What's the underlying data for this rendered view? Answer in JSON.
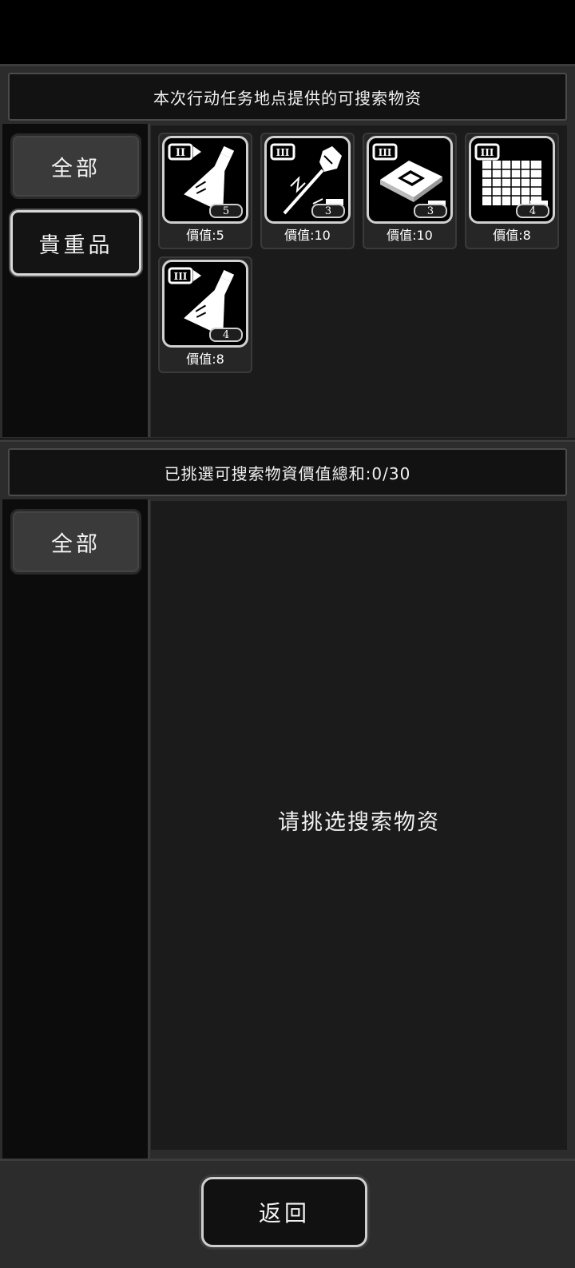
{
  "top_section": {
    "title": "本次行动任务地点提供的可搜索物资",
    "tabs": [
      {
        "label": "全部",
        "selected": false
      },
      {
        "label": "貴重品",
        "selected": true
      }
    ],
    "items": [
      {
        "icon": "flask-icon",
        "tier": "II",
        "quantity": "5",
        "value_label": "價值:5"
      },
      {
        "icon": "mace-icon",
        "tier": "III",
        "quantity": "3",
        "value_label": "價值:10"
      },
      {
        "icon": "chip-icon",
        "tier": "III",
        "quantity": "3",
        "value_label": "價值:10"
      },
      {
        "icon": "grid-sheet-icon",
        "tier": "III",
        "quantity": "4",
        "value_label": "價值:8"
      },
      {
        "icon": "flask-icon",
        "tier": "III",
        "quantity": "4",
        "value_label": "價值:8"
      }
    ]
  },
  "bottom_section": {
    "title": "已挑選可搜索物資價值總和:0/30",
    "tabs": [
      {
        "label": "全部",
        "selected": false
      }
    ],
    "empty_message": "请挑选搜索物资"
  },
  "footer": {
    "back_label": "返回"
  },
  "colors": {
    "background": "#000000",
    "panel": "#2c2c2c",
    "content": "#1b1b1b",
    "text": "#f2f2f2",
    "icon_border": "#d0d0d0"
  }
}
